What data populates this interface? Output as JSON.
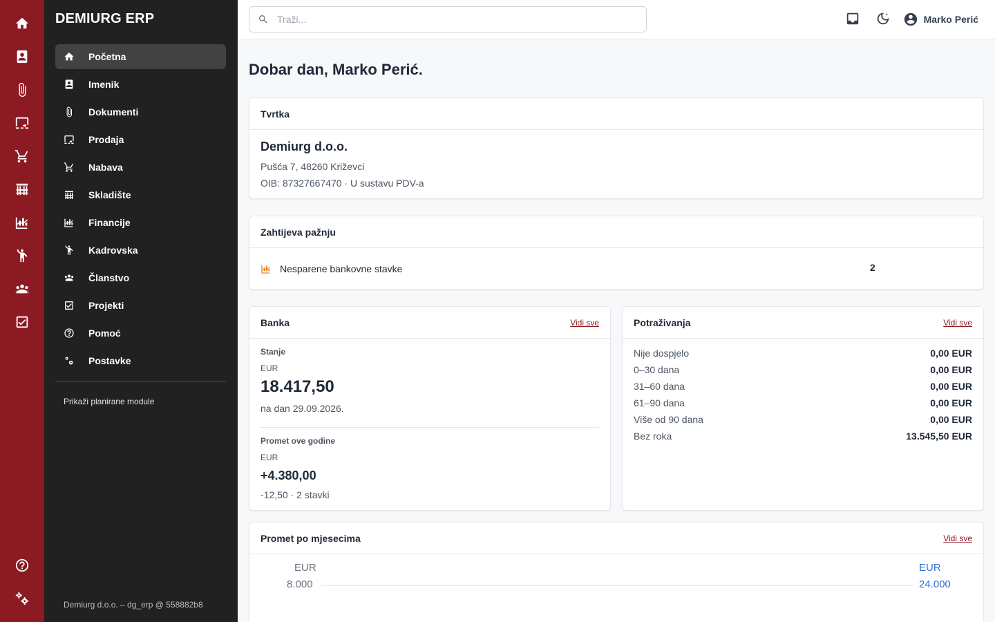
{
  "brand": "DEMIURG ERP",
  "rail": [
    {
      "icon": "home-icon"
    },
    {
      "icon": "contacts-icon"
    },
    {
      "icon": "paperclip-icon"
    },
    {
      "icon": "point-of-sale-icon"
    },
    {
      "icon": "cart-icon"
    },
    {
      "icon": "warehouse-icon"
    },
    {
      "icon": "finance-chart-icon"
    },
    {
      "icon": "person-icon"
    },
    {
      "icon": "group-icon"
    },
    {
      "icon": "checkbox-icon"
    },
    {
      "icon": "help-icon"
    },
    {
      "icon": "settings-icon"
    }
  ],
  "sidebar": {
    "items": [
      {
        "label": "Početna",
        "icon": "home-icon",
        "active": true
      },
      {
        "label": "Imenik",
        "icon": "contacts-icon"
      },
      {
        "label": "Dokumenti",
        "icon": "paperclip-icon"
      },
      {
        "label": "Prodaja",
        "icon": "point-of-sale-icon"
      },
      {
        "label": "Nabava",
        "icon": "cart-icon"
      },
      {
        "label": "Skladište",
        "icon": "warehouse-icon"
      },
      {
        "label": "Financije",
        "icon": "finance-chart-icon"
      },
      {
        "label": "Kadrovska",
        "icon": "person-icon"
      },
      {
        "label": "Članstvo",
        "icon": "group-icon"
      },
      {
        "label": "Projekti",
        "icon": "checkbox-icon"
      },
      {
        "label": "Pomoć",
        "icon": "help-icon"
      },
      {
        "label": "Postavke",
        "icon": "settings-icon"
      }
    ],
    "planned_label": "Prikaži planirane module",
    "footer": "Demiurg d.o.o. – dg_erp @ 558882b8"
  },
  "topbar": {
    "search_placeholder": "Traži...",
    "user_name": "Marko Perić"
  },
  "greeting": "Dobar dan, Marko Perić.",
  "company": {
    "title": "Tvrtka",
    "name": "Demiurg d.o.o.",
    "address": "Pušća 7, 48260 Križevci",
    "tax": "OIB: 87327667470 · U sustavu PDV-a"
  },
  "attention": {
    "title": "Zahtijeva pažnju",
    "items": [
      {
        "label": "Nesparene bankovne stavke",
        "count": "2"
      }
    ]
  },
  "bank": {
    "title": "Banka",
    "link": "Vidi sve",
    "balance_label": "Stanje",
    "balance_currency": "EUR",
    "balance": "18.417,50",
    "balance_date": "na dan 29.09.2026.",
    "turnover_label": "Promet ove godine",
    "turnover_currency": "EUR",
    "turnover": "+4.380,00",
    "turnover_sub": "-12,50 · 2 stavki"
  },
  "receivables": {
    "title": "Potraživanja",
    "link": "Vidi sve",
    "rows": [
      {
        "label": "Nije dospjelo",
        "value": "0,00 EUR"
      },
      {
        "label": "0–30 dana",
        "value": "0,00 EUR"
      },
      {
        "label": "31–60 dana",
        "value": "0,00 EUR"
      },
      {
        "label": "61–90 dana",
        "value": "0,00 EUR"
      },
      {
        "label": "Više od 90 dana",
        "value": "0,00 EUR"
      },
      {
        "label": "Bez roka",
        "value": "13.545,50 EUR"
      }
    ]
  },
  "monthly": {
    "title": "Promet po mjesecima",
    "link": "Vidi sve",
    "left_axis_unit": "EUR",
    "left_axis_top": "8.000",
    "right_axis_unit": "EUR",
    "right_axis_top": "24.000"
  },
  "colors": {
    "rail": "#8b1a22",
    "sidebar": "#212121",
    "accent": "#8b1a22",
    "attention_icon": "#e8892c",
    "right_axis": "#2f6fd1"
  }
}
